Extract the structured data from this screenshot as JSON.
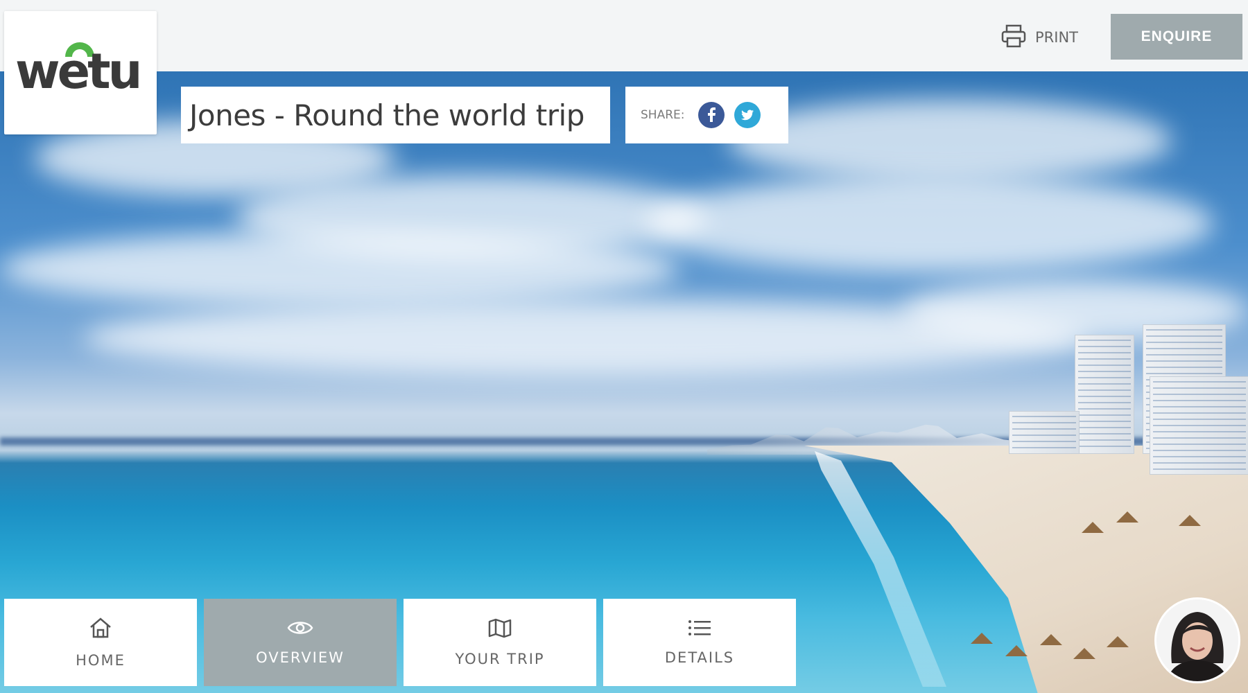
{
  "brand": {
    "logo_text": "wetu",
    "accent_color": "#52b64a"
  },
  "header": {
    "print_label": "PRINT",
    "print_icon": "printer-icon",
    "enquire_label": "ENQUIRE"
  },
  "trip": {
    "title": "Jones - Round the world trip",
    "share_label": "SHARE:",
    "share_icons": [
      "facebook-icon",
      "twitter-icon"
    ]
  },
  "nav": {
    "items": [
      {
        "label": "HOME",
        "icon": "home-icon",
        "active": false
      },
      {
        "label": "OVERVIEW",
        "icon": "eye-icon",
        "active": true
      },
      {
        "label": "YOUR TRIP",
        "icon": "map-icon",
        "active": false
      },
      {
        "label": "DETAILS",
        "icon": "list-icon",
        "active": false
      }
    ]
  },
  "colors": {
    "nav_active": "#9faaad",
    "facebook": "#3b5998",
    "twitter": "#2fa8d8"
  }
}
